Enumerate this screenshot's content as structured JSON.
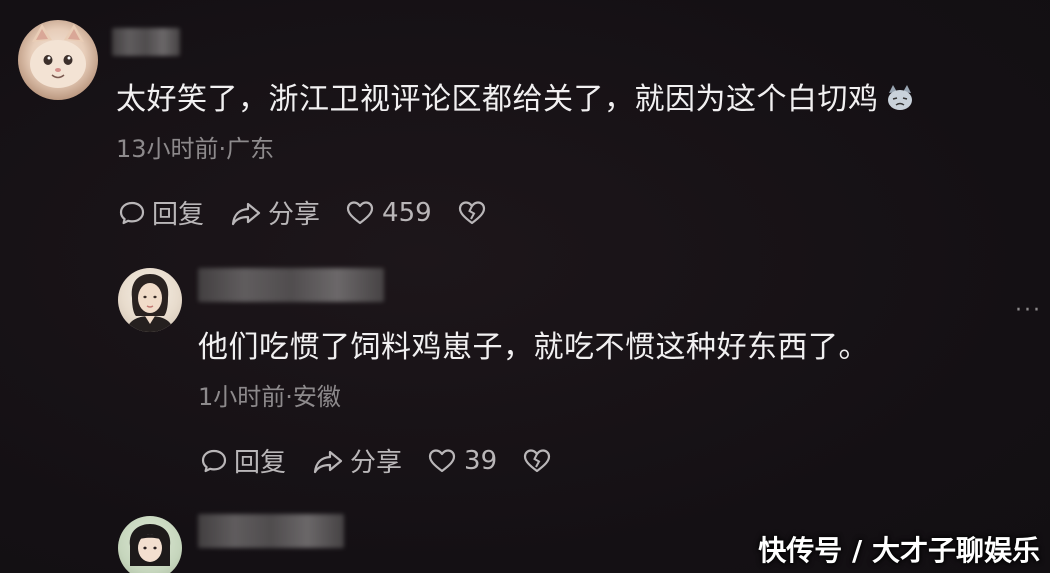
{
  "comments": [
    {
      "avatar": "cat-avatar",
      "text": "太好笑了，浙江卫视评论区都给关了，就因为这个白切鸡",
      "emoji": "cat-emoji",
      "time": "13小时前·广东",
      "reply_label": "回复",
      "share_label": "分享",
      "likes": "459"
    },
    {
      "avatar": "woman-avatar",
      "text": "他们吃惯了饲料鸡崽子，就吃不惯这种好东西了。",
      "time": "1小时前·安徽",
      "reply_label": "回复",
      "share_label": "分享",
      "likes": "39"
    },
    {
      "avatar": "girl-avatar"
    }
  ],
  "more_menu": "···",
  "watermark": "快传号 / 大才子聊娱乐",
  "colors": {
    "background": "#161216",
    "text": "#f1f0f1",
    "meta": "#8d8a8c",
    "actions": "#b9b6b8"
  }
}
